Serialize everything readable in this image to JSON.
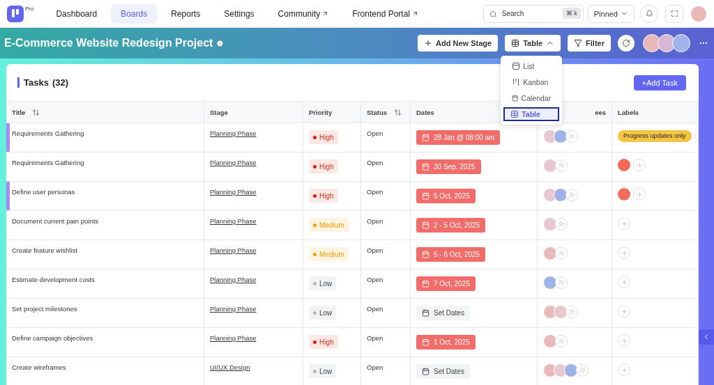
{
  "brand": {
    "badge": "Pro"
  },
  "nav": [
    {
      "label": "Dashboard",
      "selected": false,
      "external": false
    },
    {
      "label": "Boards",
      "selected": true,
      "external": false
    },
    {
      "label": "Reports",
      "selected": false,
      "external": false
    },
    {
      "label": "Settings",
      "selected": false,
      "external": false
    },
    {
      "label": "Community",
      "selected": false,
      "external": true
    },
    {
      "label": "Frontend Portal",
      "selected": false,
      "external": true
    }
  ],
  "search": {
    "placeholder": "Search",
    "shortcut": "⌘ k"
  },
  "pinned": {
    "label": "Pinned"
  },
  "project": {
    "title": "E-Commerce Website Redesign Project",
    "add_stage": "Add New Stage",
    "view": "Table",
    "filter": "Filter",
    "members": [
      {
        "color": "#e9b9b9"
      },
      {
        "color": "#d8b7d6"
      },
      {
        "color": "#9fb3e8"
      }
    ]
  },
  "view_menu": [
    {
      "label": "List",
      "kind": "list",
      "selected": false
    },
    {
      "label": "Kanban",
      "kind": "kanban",
      "selected": false
    },
    {
      "label": "Calendar",
      "kind": "calendar",
      "selected": false
    },
    {
      "label": "Table",
      "kind": "table",
      "selected": true
    }
  ],
  "tasks": {
    "title": "Tasks",
    "count": "(32)",
    "add_task": "+Add Task"
  },
  "columns": [
    {
      "label": "Title",
      "sortable": true
    },
    {
      "label": "Stage",
      "sortable": false
    },
    {
      "label": "Priority",
      "sortable": false
    },
    {
      "label": "Status",
      "sortable": true
    },
    {
      "label": "Dates",
      "sortable": false
    },
    {
      "label": "ees",
      "sortable": false
    },
    {
      "label": "Labels",
      "sortable": false
    }
  ],
  "rows": [
    {
      "title": "Requirements Gathering",
      "accent": true,
      "stage": "Planning Phase",
      "priority": {
        "label": "High",
        "kind": "high"
      },
      "status": "Open",
      "dates": {
        "text": "28 Jan @ 08:00 am",
        "set": true
      },
      "assignees": [
        {
          "color": "#e8c8cf"
        },
        {
          "color": "#9fb3e8"
        }
      ],
      "labels": [
        {
          "kind": "tag",
          "text": "Progress updates only",
          "color": "#f4c542"
        }
      ]
    },
    {
      "title": "Requirements Gathering",
      "accent": false,
      "stage": "Planning Phase",
      "priority": {
        "label": "High",
        "kind": "high"
      },
      "status": "Open",
      "dates": {
        "text": "30 Sep, 2025",
        "set": true
      },
      "assignees": [
        {
          "color": "#e8c8cf"
        }
      ],
      "labels": [
        {
          "kind": "dot",
          "color": "#f26b5b"
        }
      ]
    },
    {
      "title": "Define user personas",
      "accent": true,
      "stage": "Planning Phase",
      "priority": {
        "label": "High",
        "kind": "high"
      },
      "status": "Open",
      "dates": {
        "text": "5 Oct, 2025",
        "set": true
      },
      "assignees": [
        {
          "color": "#e8c8cf"
        },
        {
          "color": "#9fb3e8"
        }
      ],
      "labels": [
        {
          "kind": "dot",
          "color": "#f26b5b"
        }
      ]
    },
    {
      "title": "Document current pain points",
      "accent": false,
      "stage": "Planning Phase",
      "priority": {
        "label": "Medium",
        "kind": "medium"
      },
      "status": "Open",
      "dates": {
        "text": "2 - 5 Oct, 2025",
        "set": true
      },
      "assignees": [
        {
          "color": "#e8c8cf"
        }
      ],
      "labels": []
    },
    {
      "title": "Create feature wishlist",
      "accent": false,
      "stage": "Planning Phase",
      "priority": {
        "label": "Medium",
        "kind": "medium"
      },
      "status": "Open",
      "dates": {
        "text": "5 - 6 Oct, 2025",
        "set": true
      },
      "assignees": [
        {
          "color": "#e9b9b9"
        }
      ],
      "labels": []
    },
    {
      "title": "Estimate development costs",
      "accent": false,
      "stage": "Planning Phase",
      "priority": {
        "label": "Low",
        "kind": "low"
      },
      "status": "Open",
      "dates": {
        "text": "7 Oct, 2025",
        "set": true
      },
      "assignees": [
        {
          "color": "#9fb3e8"
        }
      ],
      "labels": []
    },
    {
      "title": "Set project milestones",
      "accent": false,
      "stage": "Planning Phase",
      "priority": {
        "label": "Low",
        "kind": "low"
      },
      "status": "Open",
      "dates": {
        "text": "Set Dates",
        "set": false
      },
      "assignees": [
        {
          "color": "#e9b9b9"
        },
        {
          "color": "#e8c8cf"
        }
      ],
      "labels": []
    },
    {
      "title": "Define campaign objectives",
      "accent": false,
      "stage": "Planning Phase",
      "priority": {
        "label": "High",
        "kind": "high"
      },
      "status": "Open",
      "dates": {
        "text": "1 Oct, 2025",
        "set": true
      },
      "assignees": [
        {
          "color": "#e9b9b9"
        }
      ],
      "labels": []
    },
    {
      "title": "Create wireframes",
      "accent": false,
      "stage": "UI/UX Design",
      "priority": {
        "label": "Low",
        "kind": "low"
      },
      "status": "Open",
      "dates": {
        "text": "Set Dates",
        "set": false
      },
      "assignees": [
        {
          "color": "#e9b9b9"
        },
        {
          "color": "#e8c8cf"
        },
        {
          "color": "#9fb3e8"
        }
      ],
      "labels": []
    }
  ]
}
